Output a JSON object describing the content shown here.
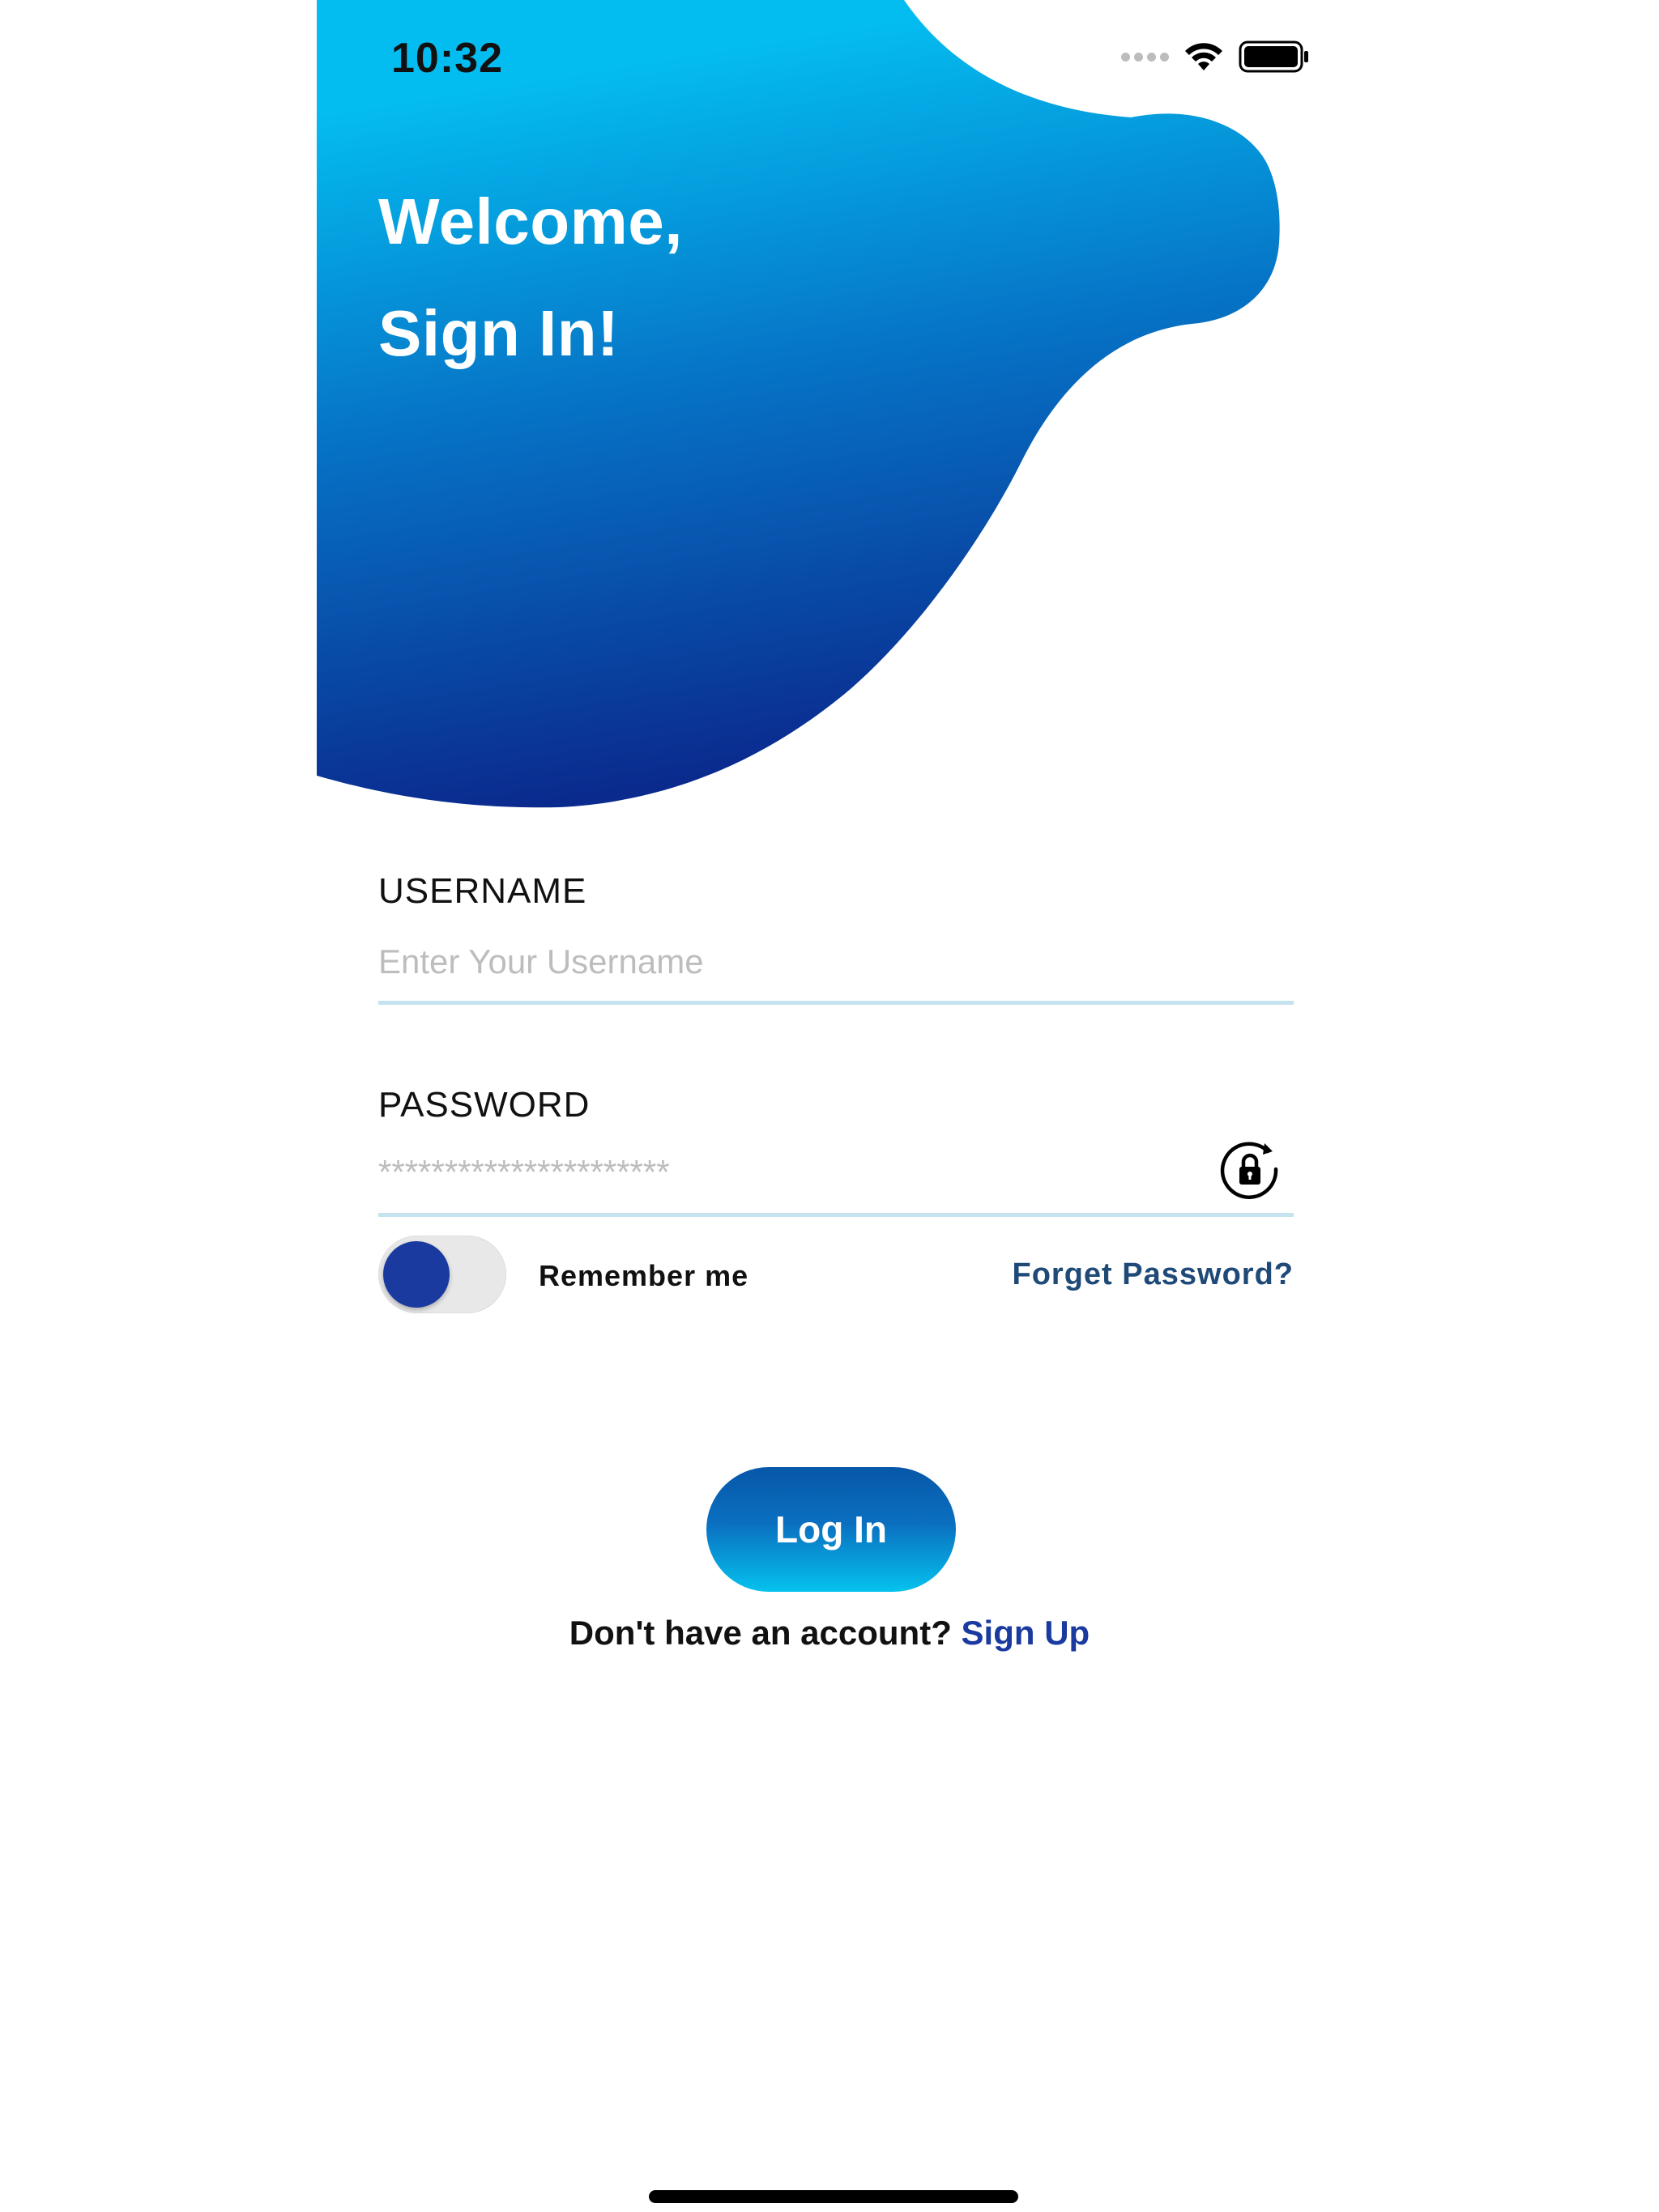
{
  "status_bar": {
    "time": "10:32"
  },
  "header": {
    "line1": "Welcome,",
    "line2": "Sign In!",
    "gradient_top": "#04bdf0",
    "gradient_bottom": "#0a2a8e"
  },
  "form": {
    "username": {
      "label": "USERNAME",
      "placeholder": "Enter Your Username",
      "value": ""
    },
    "password": {
      "label": "PASSWORD",
      "placeholder": "**********************",
      "value": ""
    },
    "remember": {
      "label": "Remember me",
      "on": true
    },
    "forget_label": "Forget Password?"
  },
  "actions": {
    "login_label": "Log In",
    "signup_prompt": "Don't have an account?",
    "signup_label": "Sign Up"
  },
  "colors": {
    "accent": "#1b3aa0",
    "underline": "#c5e4ef",
    "link": "#1f4a78"
  },
  "icons": {
    "wifi": "wifi-icon",
    "battery": "battery-icon",
    "lock": "lock-rotate-icon"
  }
}
